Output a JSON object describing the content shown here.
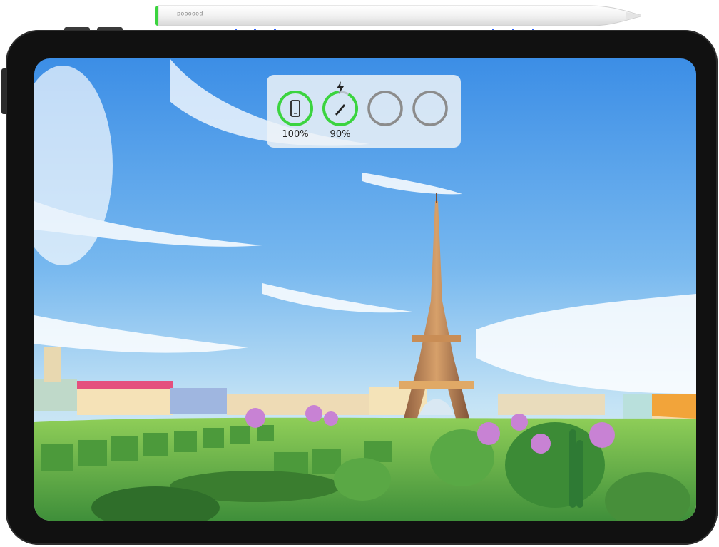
{
  "stylus": {
    "brand": "boooooq"
  },
  "battery_widget": {
    "devices": [
      {
        "name": "tablet",
        "icon": "tablet-icon",
        "percent_label": "100%",
        "level": 1.0,
        "color": "#3bd43f"
      },
      {
        "name": "pencil",
        "icon": "pencil-charging-icon",
        "percent_label": "90%",
        "level": 0.9,
        "color": "#3bd43f"
      },
      {
        "name": "empty-slot-1",
        "icon": "",
        "percent_label": "",
        "level": 0,
        "color": "#8c8c8c"
      },
      {
        "name": "empty-slot-2",
        "icon": "",
        "percent_label": "",
        "level": 0,
        "color": "#8c8c8c"
      }
    ]
  },
  "colors": {
    "accent_green": "#3bd43f",
    "magnet_blue": "#2a62ff",
    "bezel": "#111111"
  }
}
